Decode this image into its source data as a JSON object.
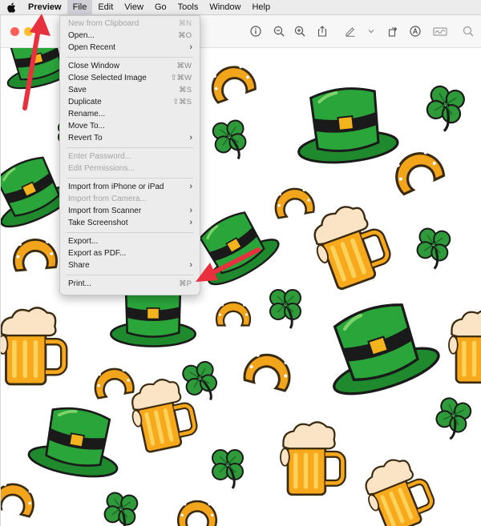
{
  "menubar": {
    "apple_icon": "apple-logo-icon",
    "items": [
      "Preview",
      "File",
      "Edit",
      "View",
      "Go",
      "Tools",
      "Window",
      "Help"
    ]
  },
  "toolbar": {
    "icons": [
      "info-icon",
      "zoom-out-icon",
      "zoom-in-icon",
      "share-icon",
      "markup-pen-icon",
      "chevron-down-icon",
      "rotate-icon",
      "markup-icon",
      "signature-icon",
      "search-icon"
    ],
    "colors": {
      "close": "#ff5f57",
      "minimize": "#febc2e"
    }
  },
  "file_menu": {
    "items": [
      {
        "label": "New from Clipboard",
        "shortcut": "⌘N",
        "disabled": true
      },
      {
        "label": "Open...",
        "shortcut": "⌘O"
      },
      {
        "label": "Open Recent",
        "submenu": true
      },
      {
        "label": "Close Window",
        "shortcut": "⌘W"
      },
      {
        "label": "Close Selected Image",
        "shortcut": "⇧⌘W"
      },
      {
        "label": "Save",
        "shortcut": "⌘S"
      },
      {
        "label": "Duplicate",
        "shortcut": "⇧⌘S"
      },
      {
        "label": "Rename..."
      },
      {
        "label": "Move To..."
      },
      {
        "label": "Revert To",
        "submenu": true
      },
      {
        "label": "Enter Password...",
        "disabled": true
      },
      {
        "label": "Edit Permissions...",
        "disabled": true
      },
      {
        "label": "Import from iPhone or iPad",
        "submenu": true
      },
      {
        "label": "Import from Camera...",
        "disabled": true
      },
      {
        "label": "Import from Scanner",
        "submenu": true
      },
      {
        "label": "Take Screenshot",
        "submenu": true
      },
      {
        "label": "Export..."
      },
      {
        "label": "Export as PDF..."
      },
      {
        "label": "Share",
        "submenu": true
      },
      {
        "label": "Print...",
        "shortcut": "⌘P"
      }
    ]
  },
  "annotation_color": "#e8303f",
  "image_theme": [
    "leprechaun-hat",
    "beer-mug",
    "horseshoe",
    "shamrock"
  ]
}
